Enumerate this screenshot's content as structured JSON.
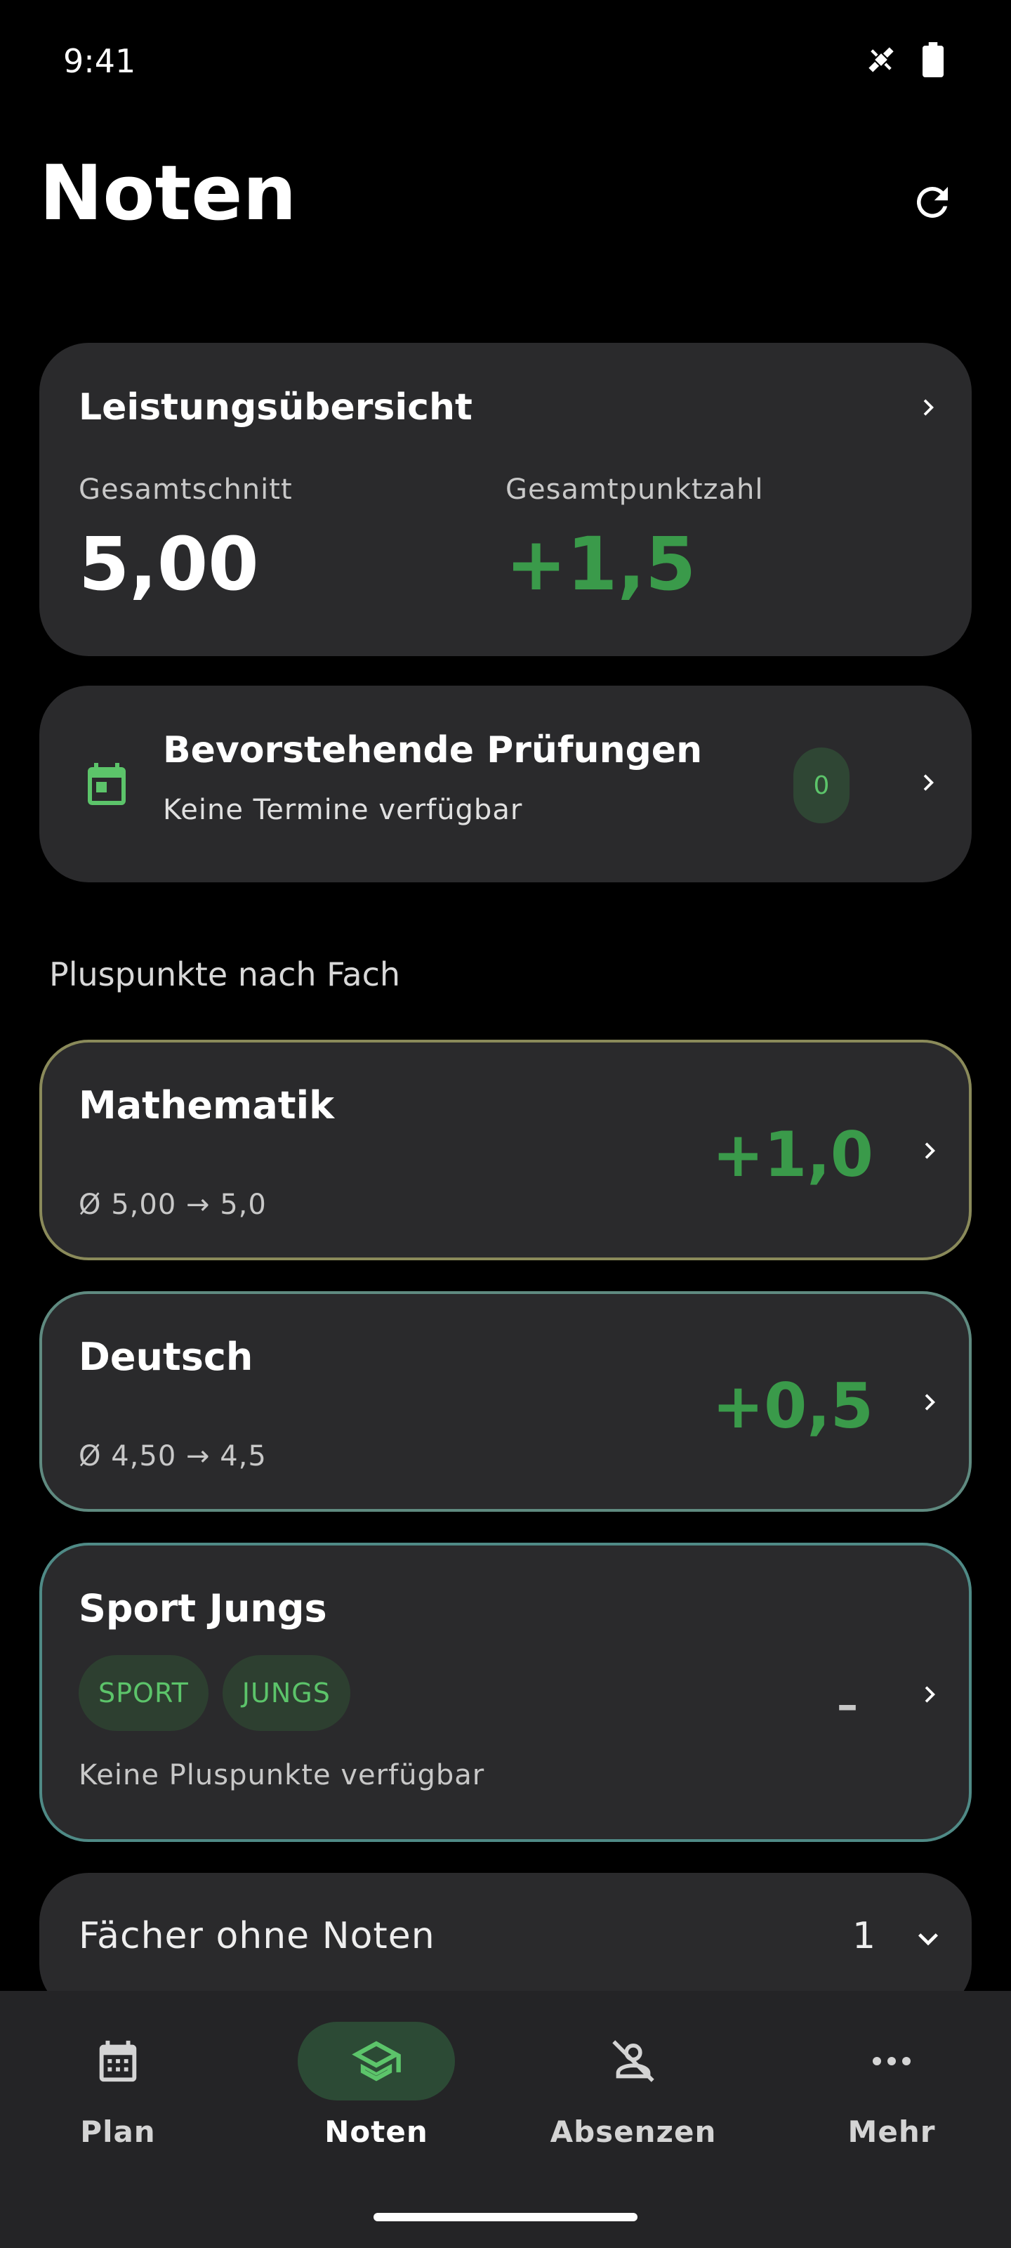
{
  "status": {
    "time": "9:41"
  },
  "header": {
    "title": "Noten"
  },
  "overview": {
    "title": "Leistungsübersicht",
    "average_label": "Gesamtschnitt",
    "average_value": "5,00",
    "points_label": "Gesamtpunktzahl",
    "points_value": "+1,5"
  },
  "exams": {
    "title": "Bevorstehende Prüfungen",
    "subtitle": "Keine Termine verfügbar",
    "count": "0"
  },
  "section": {
    "label": "Pluspunkte nach Fach"
  },
  "subjects": [
    {
      "name": "Mathematik",
      "avg": "Ø 5,00 → 5,0",
      "points": "+1,0",
      "border": "#8a8a5a"
    },
    {
      "name": "Deutsch",
      "avg": "Ø 4,50 → 4,5",
      "points": "+0,5",
      "border": "#5f8a80"
    },
    {
      "name": "Sport Jungs",
      "tags": [
        "SPORT",
        "JUNGS"
      ],
      "note": "Keine Pluspunkte verfügbar",
      "points": "–",
      "border": "#4f8a86"
    }
  ],
  "no_grades": {
    "label": "Fächer ohne Noten",
    "count": "1"
  },
  "nav": [
    {
      "label": "Plan",
      "icon": "calendar-icon"
    },
    {
      "label": "Noten",
      "icon": "graduation-cap-icon",
      "active": true
    },
    {
      "label": "Absenzen",
      "icon": "person-off-icon"
    },
    {
      "label": "Mehr",
      "icon": "more-dots-icon"
    }
  ],
  "colors": {
    "accent_green": "#3a9a4a",
    "light_green": "#5cc46a",
    "card": "#2a2a2c"
  }
}
